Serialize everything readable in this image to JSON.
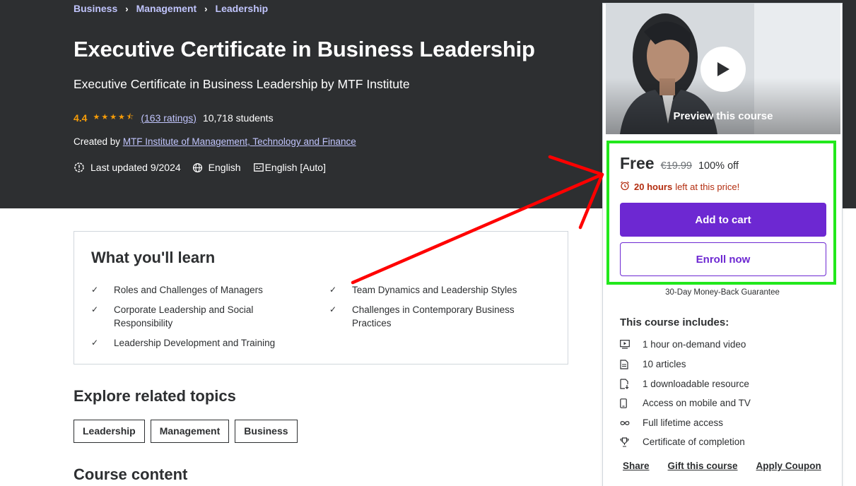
{
  "breadcrumb": [
    "Business",
    "Management",
    "Leadership"
  ],
  "course": {
    "title": "Executive Certificate in Business Leadership",
    "subtitle": "Executive Certificate in Business Leadership by MTF Institute",
    "rating": "4.4",
    "rating_stars": 4.5,
    "ratings_count": "(163 ratings)",
    "students": "10,718 students",
    "created_by_label": "Created by",
    "author": "MTF Institute of Management, Technology and Finance",
    "last_updated": "Last updated 9/2024",
    "language": "English",
    "captions": "English [Auto]"
  },
  "learn": {
    "title": "What you'll learn",
    "items": [
      "Roles and Challenges of Managers",
      "Team Dynamics and Leadership Styles",
      "Corporate Leadership and Social Responsibility",
      "Challenges in Contemporary Business Practices",
      "Leadership Development and Training"
    ]
  },
  "related": {
    "title": "Explore related topics",
    "topics": [
      "Leadership",
      "Management",
      "Business"
    ]
  },
  "content": {
    "title": "Course content"
  },
  "sidebar": {
    "preview_label": "Preview this course",
    "price_now": "Free",
    "price_old": "€19.99",
    "discount": "100% off",
    "timer_bold": "20 hours",
    "timer_rest": "left at this price!",
    "add_to_cart": "Add to cart",
    "enroll_now": "Enroll now",
    "guarantee": "30-Day Money-Back Guarantee",
    "includes_title": "This course includes:",
    "includes": [
      {
        "icon": "video-icon",
        "label": "1 hour on-demand video"
      },
      {
        "icon": "article-icon",
        "label": "10 articles"
      },
      {
        "icon": "download-file-icon",
        "label": "1 downloadable resource"
      },
      {
        "icon": "mobile-icon",
        "label": "Access on mobile and TV"
      },
      {
        "icon": "infinity-icon",
        "label": "Full lifetime access"
      },
      {
        "icon": "trophy-icon",
        "label": "Certificate of completion"
      }
    ],
    "links": [
      "Share",
      "Gift this course",
      "Apply Coupon"
    ]
  },
  "colors": {
    "hero_bg": "#2d2f31",
    "accent_purple": "#6d28d2",
    "link_lavender": "#c0c4fc",
    "star_orange": "#f69c08",
    "timer_red": "#b32d0f",
    "highlight_green": "#22e81c",
    "annotation_arrow_red": "#ff0000"
  }
}
